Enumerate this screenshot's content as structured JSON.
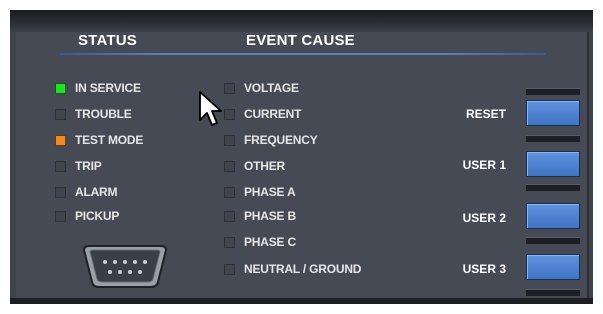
{
  "headings": {
    "status": "STATUS",
    "event_cause": "EVENT CAUSE"
  },
  "status_items": [
    {
      "label": "IN SERVICE",
      "led": "green",
      "color": "#22e022"
    },
    {
      "label": "TROUBLE",
      "led": "off"
    },
    {
      "label": "TEST MODE",
      "led": "orange",
      "color": "#f28a24"
    },
    {
      "label": "TRIP",
      "led": "off"
    },
    {
      "label": "ALARM",
      "led": "off"
    },
    {
      "label": "PICKUP",
      "led": "off"
    }
  ],
  "event_items": [
    {
      "label": "VOLTAGE",
      "led": "off"
    },
    {
      "label": "CURRENT",
      "led": "off"
    },
    {
      "label": "FREQUENCY",
      "led": "off"
    },
    {
      "label": "OTHER",
      "led": "off"
    },
    {
      "label": "PHASE A",
      "led": "off"
    },
    {
      "label": "PHASE B",
      "led": "off"
    },
    {
      "label": "PHASE C",
      "led": "off"
    },
    {
      "label": "NEUTRAL / GROUND",
      "led": "off"
    }
  ],
  "buttons": [
    {
      "label": "RESET"
    },
    {
      "label": "USER 1"
    },
    {
      "label": "USER 2"
    },
    {
      "label": "USER 3"
    }
  ],
  "icons": {
    "connector": "db9-serial-port-icon",
    "cursor": "mouse-pointer-icon"
  },
  "colors": {
    "panel": "#454a54",
    "button": "#4a82d2",
    "rule": "#5a7fb5"
  }
}
